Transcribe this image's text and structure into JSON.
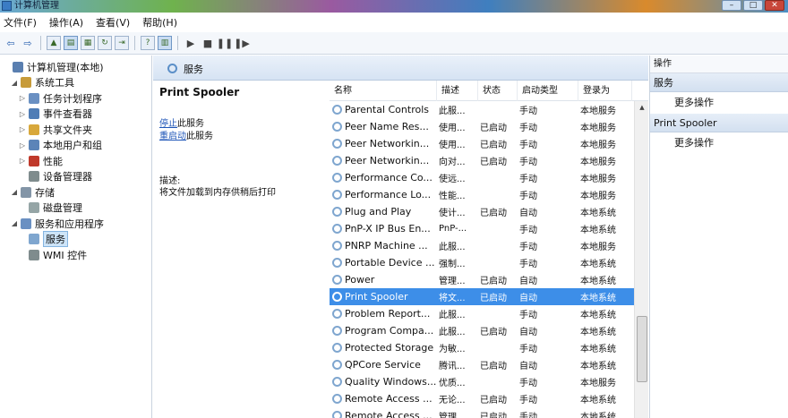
{
  "titlebar": {
    "title": "计算机管理"
  },
  "menu": [
    "文件(F)",
    "操作(A)",
    "查看(V)",
    "帮助(H)"
  ],
  "tree": [
    {
      "label": "计算机管理(本地)",
      "indent": 0,
      "arrow": "",
      "color": "#5a7fb0"
    },
    {
      "label": "系统工具",
      "indent": 1,
      "arrow": "◢",
      "color": "#c79b3a"
    },
    {
      "label": "任务计划程序",
      "indent": 2,
      "arrow": "▷",
      "color": "#6a90c2"
    },
    {
      "label": "事件查看器",
      "indent": 2,
      "arrow": "▷",
      "color": "#4f7db6"
    },
    {
      "label": "共享文件夹",
      "indent": 2,
      "arrow": "▷",
      "color": "#d8a83b"
    },
    {
      "label": "本地用户和组",
      "indent": 2,
      "arrow": "▷",
      "color": "#5c84b8"
    },
    {
      "label": "性能",
      "indent": 2,
      "arrow": "▷",
      "color": "#c0392b"
    },
    {
      "label": "设备管理器",
      "indent": 2,
      "arrow": "",
      "color": "#7f8c8d"
    },
    {
      "label": "存储",
      "indent": 1,
      "arrow": "◢",
      "color": "#8395a7"
    },
    {
      "label": "磁盘管理",
      "indent": 2,
      "arrow": "",
      "color": "#95a5a6"
    },
    {
      "label": "服务和应用程序",
      "indent": 1,
      "arrow": "◢",
      "color": "#6a90c2"
    },
    {
      "label": "服务",
      "indent": 2,
      "arrow": "",
      "color": "#7fa6cf",
      "selected": true
    },
    {
      "label": "WMI 控件",
      "indent": 2,
      "arrow": "",
      "color": "#7f8c8d"
    }
  ],
  "middle": {
    "header_title": "服务",
    "detail": {
      "name": "Print Spooler",
      "link1_action": "停止",
      "link1_suffix": "此服务",
      "link2_action": "重启动",
      "link2_suffix": "此服务",
      "desc_label": "描述:",
      "desc_text": "将文件加载到内存供稍后打印"
    },
    "columns": [
      "名称",
      "描述",
      "状态",
      "启动类型",
      "登录为"
    ],
    "rows": [
      [
        "Parental Controls",
        "此服...",
        "",
        "手动",
        "本地服务"
      ],
      [
        "Peer Name Res...",
        "使用...",
        "已启动",
        "手动",
        "本地服务"
      ],
      [
        "Peer Networkin...",
        "使用...",
        "已启动",
        "手动",
        "本地服务"
      ],
      [
        "Peer Networkin...",
        "向对...",
        "已启动",
        "手动",
        "本地服务"
      ],
      [
        "Performance Co...",
        "使远...",
        "",
        "手动",
        "本地服务"
      ],
      [
        "Performance Lo...",
        "性能...",
        "",
        "手动",
        "本地服务"
      ],
      [
        "Plug and Play",
        "使计...",
        "已启动",
        "自动",
        "本地系统"
      ],
      [
        "PnP-X IP Bus En...",
        "PnP-...",
        "",
        "手动",
        "本地系统"
      ],
      [
        "PNRP Machine ...",
        "此服...",
        "",
        "手动",
        "本地服务"
      ],
      [
        "Portable Device ...",
        "强制...",
        "",
        "手动",
        "本地系统"
      ],
      [
        "Power",
        "管理...",
        "已启动",
        "自动",
        "本地系统"
      ],
      [
        "Print Spooler",
        "将文...",
        "已启动",
        "自动",
        "本地系统"
      ],
      [
        "Problem Report...",
        "此服...",
        "",
        "手动",
        "本地系统"
      ],
      [
        "Program Compa...",
        "此服...",
        "已启动",
        "自动",
        "本地系统"
      ],
      [
        "Protected Storage",
        "为敏...",
        "",
        "手动",
        "本地系统"
      ],
      [
        "QPCore Service",
        "腾讯...",
        "已启动",
        "自动",
        "本地系统"
      ],
      [
        "Quality Windows...",
        "优质...",
        "",
        "手动",
        "本地服务"
      ],
      [
        "Remote Access ...",
        "无论...",
        "已启动",
        "手动",
        "本地系统"
      ],
      [
        "Remote Access ...",
        "管理...",
        "已启动",
        "手动",
        "本地系统"
      ]
    ],
    "selected_row": 11
  },
  "actions": {
    "header": "操作",
    "section1": "服务",
    "more1": "更多操作",
    "section2": "Print Spooler",
    "more2": "更多操作"
  }
}
